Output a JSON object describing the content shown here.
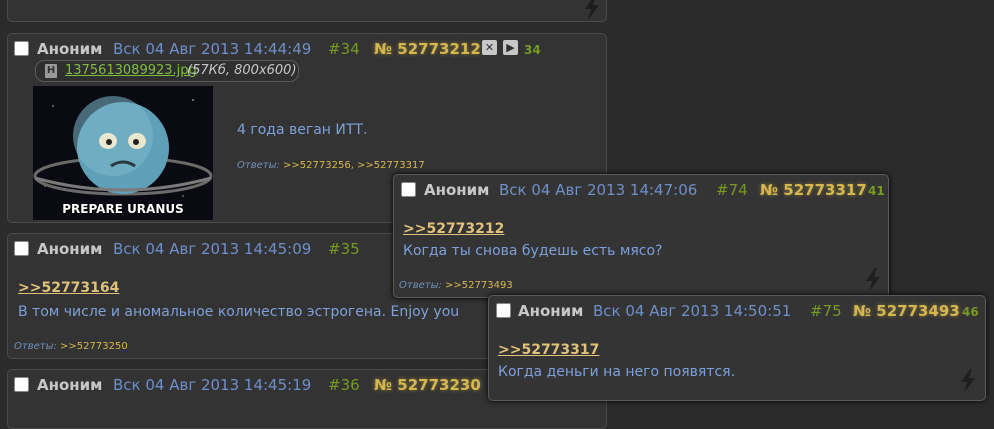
{
  "posts": [
    {
      "name": "Аноним",
      "date": "Вск 04 Авг 2013 14:44:49",
      "num": "#34",
      "id_label": "№",
      "id": "52773212",
      "reply_count": "34",
      "file": {
        "name": "1375613089923.jpg",
        "meta": "(57Кб, 800x600)"
      },
      "thumb_caption": "PREPARE URANUS",
      "text": "4 года веган ИТТ.",
      "answers_label": "Ответы:",
      "answers": ">>52773256, >>52773317"
    },
    {
      "name": "Аноним",
      "date": "Вск 04 Авг 2013 14:45:09",
      "num": "#35",
      "reply_link": ">>52773164",
      "text": "В том числе и аномальное количество эстрогена. Enjoy you",
      "answers_label": "Ответы:",
      "answers": ">>52773250"
    },
    {
      "name": "Аноним",
      "date": "Вск 04 Авг 2013 14:45:19",
      "num": "#36",
      "id_label": "№",
      "id": "52773230"
    }
  ],
  "popups": [
    {
      "name": "Аноним",
      "date": "Вск 04 Авг 2013 14:47:06",
      "num": "#74",
      "id_label": "№",
      "id": "52773317",
      "reply_count": "41",
      "reply_link": ">>52773212",
      "text": "Когда ты снова будешь есть мясо?",
      "answers_label": "Ответы:",
      "answers": ">>52773493"
    },
    {
      "name": "Аноним",
      "date": "Вск 04 Авг 2013 14:50:51",
      "num": "#75",
      "id_label": "№",
      "id": "52773493",
      "reply_count": "46",
      "reply_link": ">>52773317",
      "text": "Когда деньги на него появятся."
    }
  ]
}
